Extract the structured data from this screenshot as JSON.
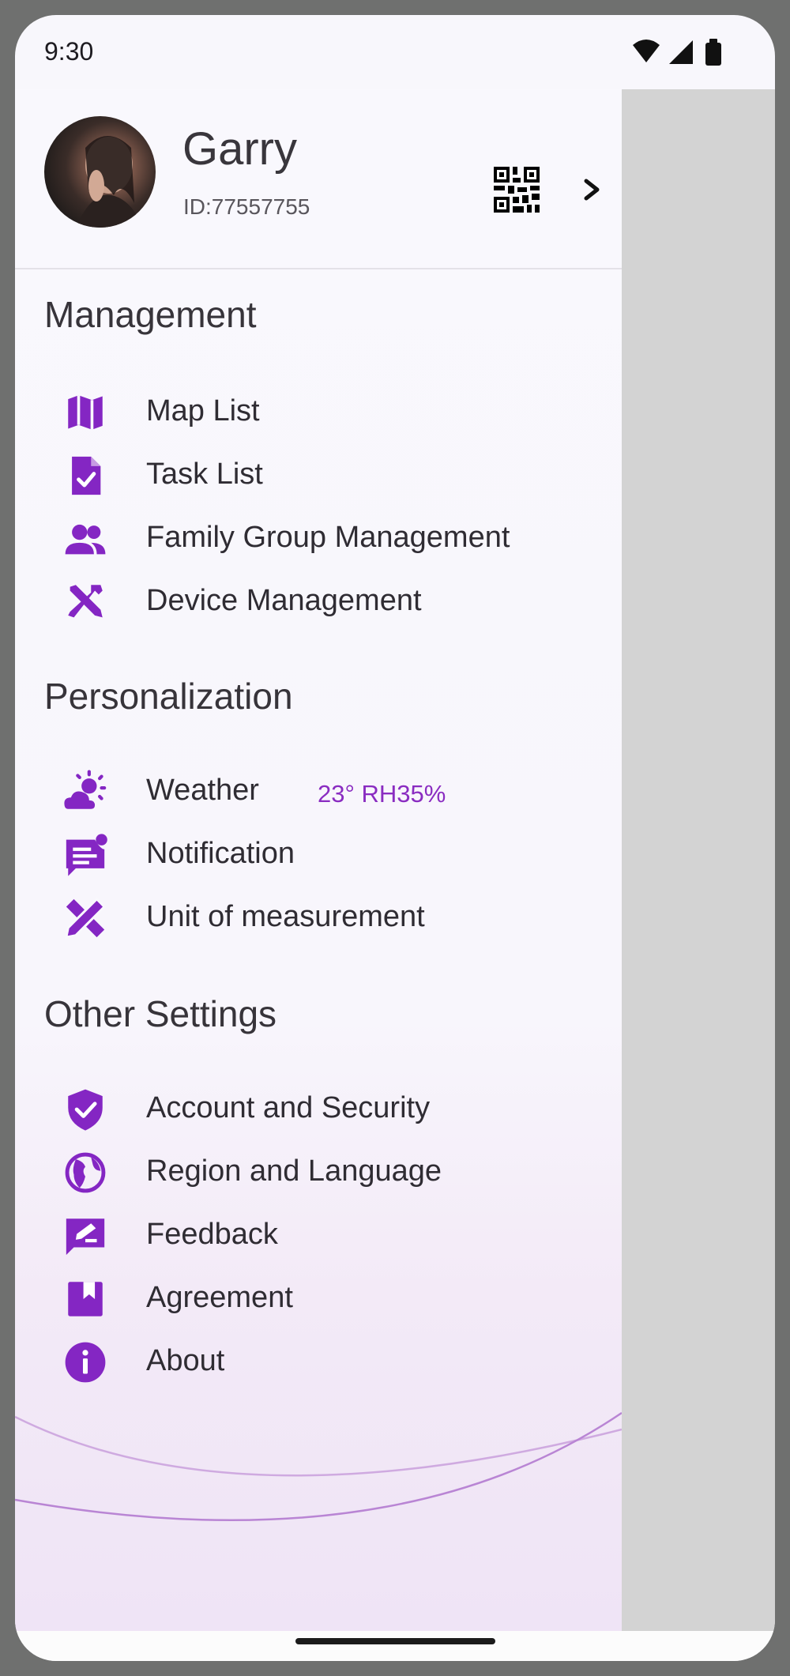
{
  "status_bar": {
    "time": "9:30"
  },
  "profile": {
    "name": "Garry",
    "user_id": "ID:77557755"
  },
  "icon_color": "#8426c3",
  "sections": {
    "management": {
      "title": "Management",
      "items": [
        {
          "label": "Map List",
          "icon": "map-icon"
        },
        {
          "label": "Task List",
          "icon": "task-list-icon"
        },
        {
          "label": "Family Group Management",
          "icon": "group-icon"
        },
        {
          "label": "Device Management",
          "icon": "tools-icon"
        }
      ]
    },
    "personalization": {
      "title": "Personalization",
      "items": [
        {
          "label": "Weather",
          "icon": "weather-icon",
          "extra": "23° RH35%"
        },
        {
          "label": "Notification",
          "icon": "notification-icon"
        },
        {
          "label": "Unit of measurement",
          "icon": "ruler-pencil-icon"
        }
      ]
    },
    "other": {
      "title": "Other Settings",
      "items": [
        {
          "label": "Account and Security",
          "icon": "shield-check-icon"
        },
        {
          "label": "Region and Language",
          "icon": "globe-icon"
        },
        {
          "label": "Feedback",
          "icon": "feedback-icon"
        },
        {
          "label": "Agreement",
          "icon": "bookmark-icon"
        },
        {
          "label": "About",
          "icon": "info-icon"
        }
      ]
    }
  }
}
